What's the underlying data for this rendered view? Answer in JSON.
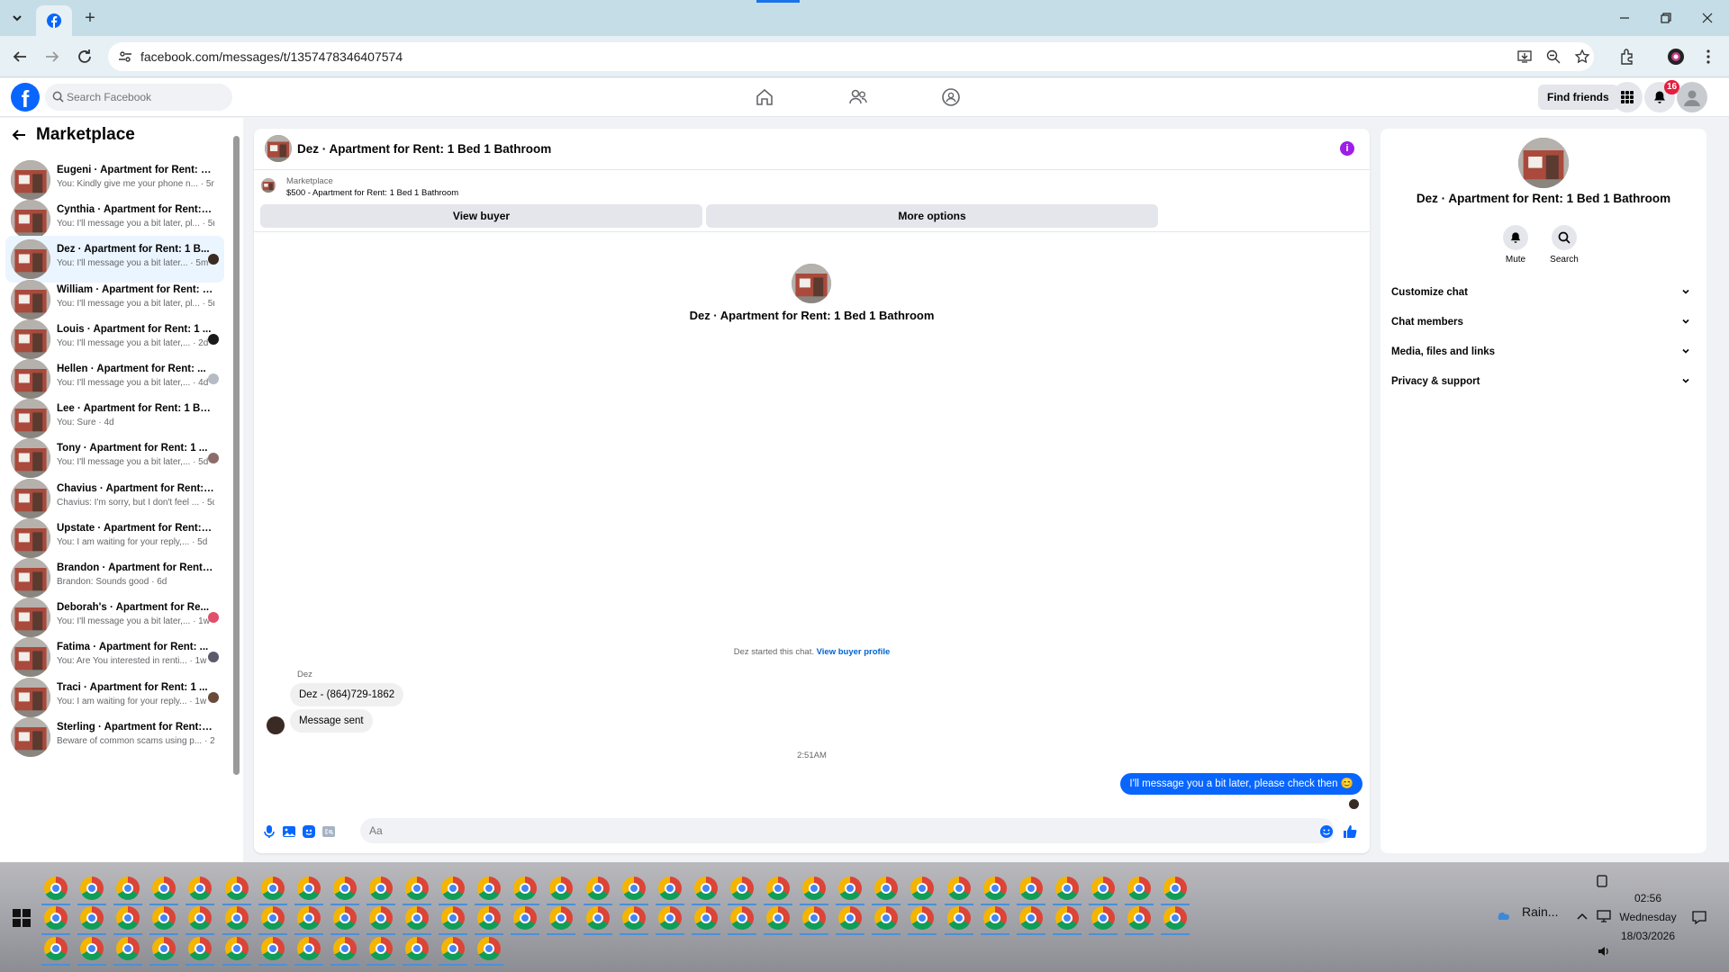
{
  "browser": {
    "url": "facebook.com/messages/t/1357478346407574",
    "new_tab_symbol": "+"
  },
  "fb_header": {
    "search_placeholder": "Search Facebook",
    "find_friends_label": "Find friends",
    "notification_count": "16"
  },
  "left_panel": {
    "title": "Marketplace",
    "conversations": [
      {
        "name": "Eugeni · Apartment for Rent: 1 ...",
        "preview": "You: Kindly give me your phone n... · 5m",
        "active": false,
        "dot_color": ""
      },
      {
        "name": "Cynthia · Apartment for Rent: 1 ...",
        "preview": "You: I'll message you a bit later, pl... · 5m",
        "active": false,
        "dot_color": ""
      },
      {
        "name": "Dez · Apartment for Rent: 1 B...",
        "preview": "You: I'll message you a bit later... · 5m",
        "active": true,
        "dot_color": "#3a2a24"
      },
      {
        "name": "William · Apartment for Rent: 1 ...",
        "preview": "You: I'll message you a bit later, pl... · 5m",
        "active": false,
        "dot_color": ""
      },
      {
        "name": "Louis · Apartment for Rent: 1 ...",
        "preview": "You: I'll message you a bit later,... · 2d",
        "active": false,
        "dot_color": "#1a1a1a"
      },
      {
        "name": "Hellen · Apartment for Rent: ...",
        "preview": "You: I'll message you a bit later,... · 4d",
        "active": false,
        "dot_color": "#b7bcc4"
      },
      {
        "name": "Lee · Apartment for Rent: 1 Bed...",
        "preview": "You: Sure · 4d",
        "active": false,
        "dot_color": ""
      },
      {
        "name": "Tony · Apartment for Rent: 1 ...",
        "preview": "You: I'll message you a bit later,... · 5d",
        "active": false,
        "dot_color": "#8a6d6a"
      },
      {
        "name": "Chavius · Apartment for Rent: 1 ...",
        "preview": "Chavius: I'm sorry, but I don't feel ... · 5d",
        "active": false,
        "dot_color": ""
      },
      {
        "name": "Upstate · Apartment for Rent: 1 ...",
        "preview": "You: I am waiting for your reply,... · 5d",
        "active": false,
        "dot_color": ""
      },
      {
        "name": "Brandon · Apartment for Rent: ...",
        "preview": "Brandon: Sounds good · 6d",
        "active": false,
        "dot_color": ""
      },
      {
        "name": "Deborah's · Apartment for Re...",
        "preview": "You: I'll message you a bit later,... · 1w",
        "active": false,
        "dot_color": "#e0506a"
      },
      {
        "name": "Fatima · Apartment for Rent: ...",
        "preview": "You: Are You interested in renti... · 1w",
        "active": false,
        "dot_color": "#5a5a6a"
      },
      {
        "name": "Traci · Apartment for Rent: 1 ...",
        "preview": "You: I am waiting for your reply... · 1w",
        "active": false,
        "dot_color": "#6a4a3a"
      },
      {
        "name": "Sterling · Apartment for Rent: 1 ...",
        "preview": "Beware of common scams using p... · 2w",
        "active": false,
        "dot_color": ""
      }
    ]
  },
  "chat": {
    "title": "Dez · Apartment for Rent: 1 Bed 1 Bathroom",
    "listing_source": "Marketplace",
    "listing_price_title": "$500 - Apartment for Rent: 1 Bed 1 Bathroom",
    "view_buyer_label": "View buyer",
    "more_options_label": "More options",
    "center_title": "Dez · Apartment for Rent: 1 Bed 1 Bathroom",
    "started_text": "Dez started this chat.",
    "view_buyer_profile_label": "View buyer profile",
    "sender_name": "Dez",
    "incoming_messages": [
      "Dez - (864)729-1862",
      "Message sent"
    ],
    "time_label": "2:51AM",
    "outgoing_message": "I'll message you a bit later, please check then 😊",
    "composer_placeholder": "Aa"
  },
  "right_panel": {
    "title": "Dez · Apartment for Rent: 1 Bed 1 Bathroom",
    "mute_label": "Mute",
    "search_label": "Search",
    "sections": [
      "Customize chat",
      "Chat members",
      "Media, files and links",
      "Privacy & support"
    ]
  },
  "taskbar": {
    "weather": "Rain...",
    "time": "02:56",
    "day": "Wednesday",
    "date": "18/03/2026"
  },
  "colors": {
    "fb_blue": "#0866ff",
    "active_conversation": "#ebf5ff",
    "info_purple": "#9d1ee6",
    "badge_red": "#e41e3f"
  }
}
